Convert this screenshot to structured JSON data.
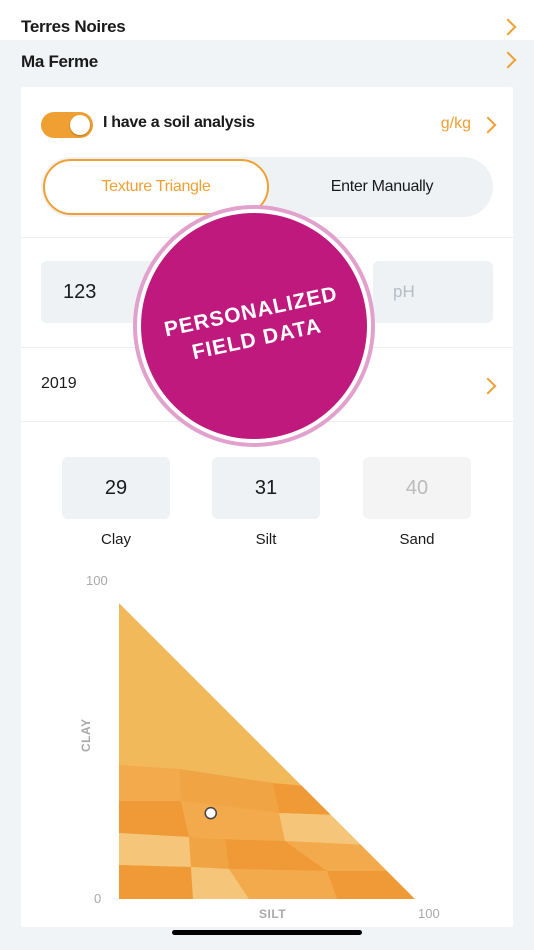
{
  "nav": {
    "region": "Terres Noires",
    "farm": "Ma Ferme"
  },
  "soil": {
    "toggle_label": "I have a soil analysis",
    "toggle_on": true,
    "unit": "g/kg",
    "tabs": [
      "Texture Triangle",
      "Enter Manually"
    ],
    "active_tab": 0,
    "value_field": "123",
    "ph_placeholder": "pH",
    "year": "2019",
    "components": [
      {
        "label": "Clay",
        "value": "29",
        "editable": true
      },
      {
        "label": "Silt",
        "value": "31",
        "editable": true
      },
      {
        "label": "Sand",
        "value": "40",
        "editable": false
      }
    ]
  },
  "triangle": {
    "axis_max": "100",
    "axis_min": "0",
    "clay_title": "CLAY",
    "silt_title": "SILT",
    "silt_max": "100",
    "selected": {
      "clay": 29,
      "silt": 31,
      "sand": 40
    },
    "colors": {
      "base": "#f2b95b",
      "mid": "#f3a94a",
      "dark": "#ef9a37",
      "light": "#f5c57a"
    }
  },
  "badge": {
    "line1": "PERSONALIZED",
    "line2": "FIELD DATA",
    "color": "#c0197e"
  },
  "theme": {
    "accent": "#f0a033"
  }
}
